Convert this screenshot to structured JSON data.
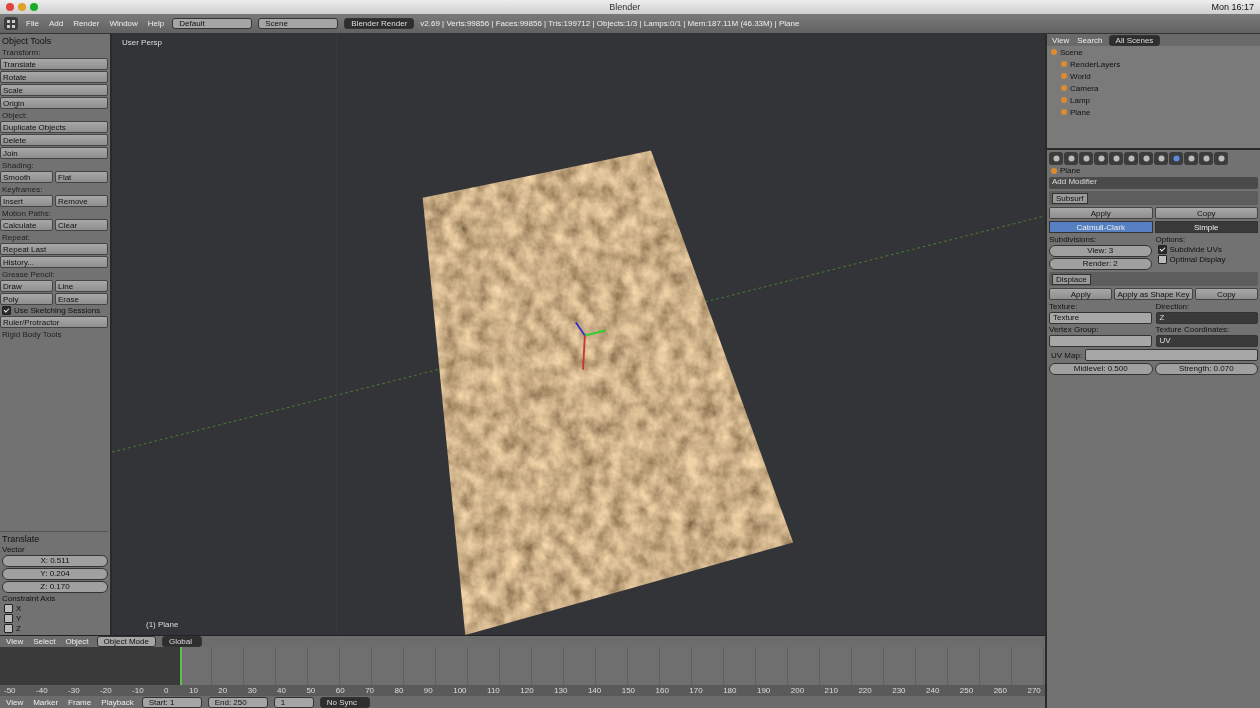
{
  "menubar": {
    "app": "Blender",
    "clock": "Mon 16:17"
  },
  "info_header": {
    "menus": [
      "File",
      "Add",
      "Render",
      "Window",
      "Help"
    ],
    "layout": "Default",
    "scene": "Scene",
    "engine": "Blender Render",
    "stats": "v2.69 | Verts:99856 | Faces:99856 | Tris:199712 | Objects:1/3 | Lamps:0/1 | Mem:187.11M (46.33M) | Plane"
  },
  "tool_shelf": {
    "title": "Object Tools",
    "sections": [
      {
        "title": "Transform:",
        "rows": [
          [
            "Translate"
          ],
          [
            "Rotate"
          ],
          [
            "Scale"
          ],
          [
            "Origin"
          ]
        ]
      },
      {
        "title": "Object:",
        "rows": [
          [
            "Duplicate Objects"
          ],
          [
            "Delete"
          ],
          [
            "Join"
          ]
        ]
      },
      {
        "title": "Shading:",
        "rows": [
          [
            "Smooth",
            "Flat"
          ]
        ]
      },
      {
        "title": "Keyframes:",
        "rows": [
          [
            "Insert",
            "Remove"
          ]
        ]
      },
      {
        "title": "Motion Paths:",
        "rows": [
          [
            "Calculate",
            "Clear"
          ]
        ]
      },
      {
        "title": "Repeat:",
        "rows": [
          [
            "Repeat Last"
          ],
          [
            "History..."
          ]
        ]
      },
      {
        "title": "Grease Pencil:",
        "rows": [
          [
            "Draw",
            "Line"
          ],
          [
            "Poly",
            "Erase"
          ]
        ]
      }
    ],
    "sketching": {
      "label": "Use Sketching Sessions",
      "checked": true
    },
    "ruler": "Ruler/Protractor",
    "collapsed": "Rigid Body Tools"
  },
  "operator": {
    "title": "Translate",
    "label": "Vector",
    "values": [
      "X: 0.511",
      "Y: 0.204",
      "Z: 0.170"
    ],
    "axis_label": "Constraint Axis",
    "axes": [
      {
        "label": "X",
        "checked": false
      },
      {
        "label": "Y",
        "checked": false
      },
      {
        "label": "Z",
        "checked": false
      }
    ]
  },
  "viewport": {
    "view_name": "User Persp",
    "object_name": "(1) Plane"
  },
  "view_header": {
    "menus": [
      "View",
      "Select",
      "Object"
    ],
    "mode": "Object Mode",
    "orientation": "Global"
  },
  "ruler": [
    "-50",
    "-40",
    "-30",
    "-20",
    "-10",
    "0",
    "10",
    "20",
    "30",
    "40",
    "50",
    "60",
    "70",
    "80",
    "90",
    "100",
    "110",
    "120",
    "130",
    "140",
    "150",
    "160",
    "170",
    "180",
    "190",
    "200",
    "210",
    "220",
    "230",
    "240",
    "250",
    "260",
    "270"
  ],
  "timeline_header": {
    "menus": [
      "View",
      "Marker",
      "Frame",
      "Playback"
    ],
    "start": "Start: 1",
    "end": "End: 250",
    "frame": "1",
    "sync": "No Sync"
  },
  "outliner": {
    "menus": [
      "View",
      "Search"
    ],
    "filter": "All Scenes",
    "tree": [
      {
        "label": "Scene",
        "children": [
          {
            "label": "RenderLayers"
          },
          {
            "label": "World"
          },
          {
            "label": "Camera"
          },
          {
            "label": "Lamp"
          },
          {
            "label": "Plane"
          }
        ]
      }
    ]
  },
  "properties": {
    "context": "Plane",
    "add_modifier": "Add Modifier",
    "subsurf": {
      "name": "Subsurf",
      "apply": "Apply",
      "copy": "Copy",
      "types": [
        {
          "label": "Catmull-Clark",
          "selected": true
        },
        {
          "label": "Simple",
          "selected": false
        }
      ],
      "subdiv_label": "Subdivisions:",
      "view": "View: 3",
      "render": "Render: 2",
      "options_label": "Options:",
      "options": [
        {
          "label": "Subdivide UVs",
          "checked": true
        },
        {
          "label": "Optimal Display",
          "checked": false
        }
      ]
    },
    "displace": {
      "name": "Displace",
      "buttons": [
        "Apply",
        "Apply as Shape Key",
        "Copy"
      ],
      "texture_label": "Texture:",
      "texture": "Texture",
      "direction_label": "Direction:",
      "direction": "Z",
      "vgroup_label": "Vertex Group:",
      "coords_label": "Texture Coordinates:",
      "coords": "UV",
      "uvmap_label": "UV Map:",
      "midlevel": "Midlevel: 0.500",
      "strength": "Strength: 0.070"
    }
  }
}
